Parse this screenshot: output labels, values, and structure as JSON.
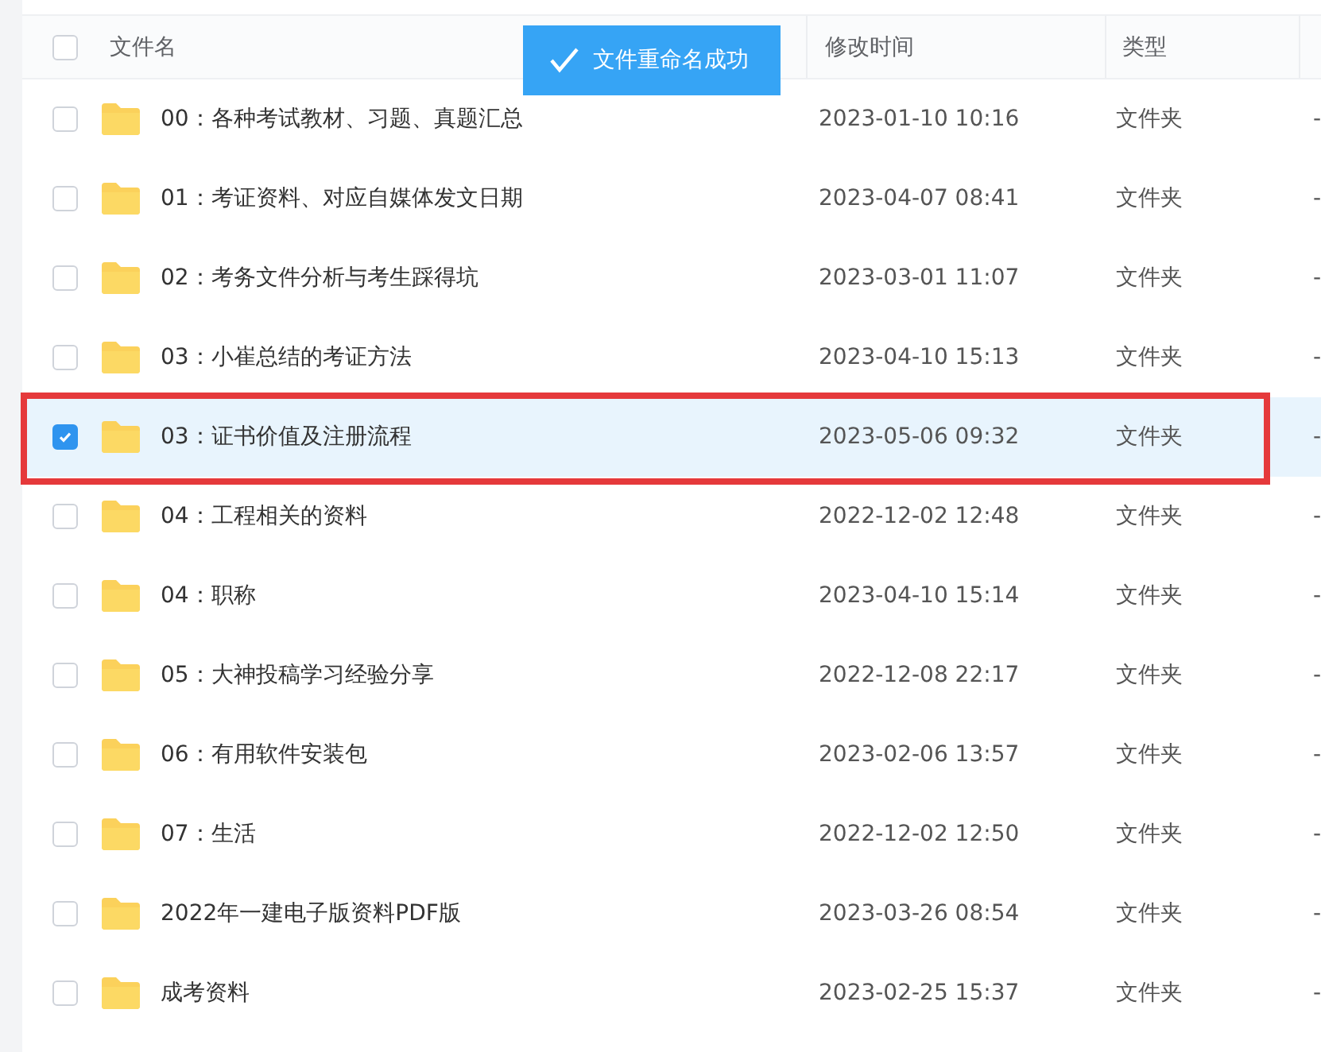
{
  "toast": {
    "text": "文件重命名成功"
  },
  "table": {
    "columns": [
      "文件名",
      "修改时间",
      "类型"
    ],
    "all_checked": false,
    "rows": [
      {
        "name": "00：各种考试教材、习题、真题汇总",
        "modified": "2023-01-10 10:16",
        "type": "文件夹",
        "size": "-",
        "selected": false,
        "highlighted": false
      },
      {
        "name": "01：考证资料、对应自媒体发文日期",
        "modified": "2023-04-07 08:41",
        "type": "文件夹",
        "size": "-",
        "selected": false,
        "highlighted": false
      },
      {
        "name": "02：考务文件分析与考生踩得坑",
        "modified": "2023-03-01 11:07",
        "type": "文件夹",
        "size": "-",
        "selected": false,
        "highlighted": false
      },
      {
        "name": "03：小崔总结的考证方法",
        "modified": "2023-04-10 15:13",
        "type": "文件夹",
        "size": "-",
        "selected": false,
        "highlighted": false
      },
      {
        "name": "03：证书价值及注册流程",
        "modified": "2023-05-06 09:32",
        "type": "文件夹",
        "size": "-",
        "selected": true,
        "highlighted": true
      },
      {
        "name": "04：工程相关的资料",
        "modified": "2022-12-02 12:48",
        "type": "文件夹",
        "size": "-",
        "selected": false,
        "highlighted": false
      },
      {
        "name": "04：职称",
        "modified": "2023-04-10 15:14",
        "type": "文件夹",
        "size": "-",
        "selected": false,
        "highlighted": false
      },
      {
        "name": "05：大神投稿学习经验分享",
        "modified": "2022-12-08 22:17",
        "type": "文件夹",
        "size": "-",
        "selected": false,
        "highlighted": false
      },
      {
        "name": "06：有用软件安装包",
        "modified": "2023-02-06 13:57",
        "type": "文件夹",
        "size": "-",
        "selected": false,
        "highlighted": false
      },
      {
        "name": "07：生活",
        "modified": "2022-12-02 12:50",
        "type": "文件夹",
        "size": "-",
        "selected": false,
        "highlighted": false
      },
      {
        "name": "2022年一建电子版资料PDF版",
        "modified": "2023-03-26 08:54",
        "type": "文件夹",
        "size": "-",
        "selected": false,
        "highlighted": false
      },
      {
        "name": "成考资料",
        "modified": "2023-02-25 15:37",
        "type": "文件夹",
        "size": "-",
        "selected": false,
        "highlighted": false
      }
    ]
  }
}
